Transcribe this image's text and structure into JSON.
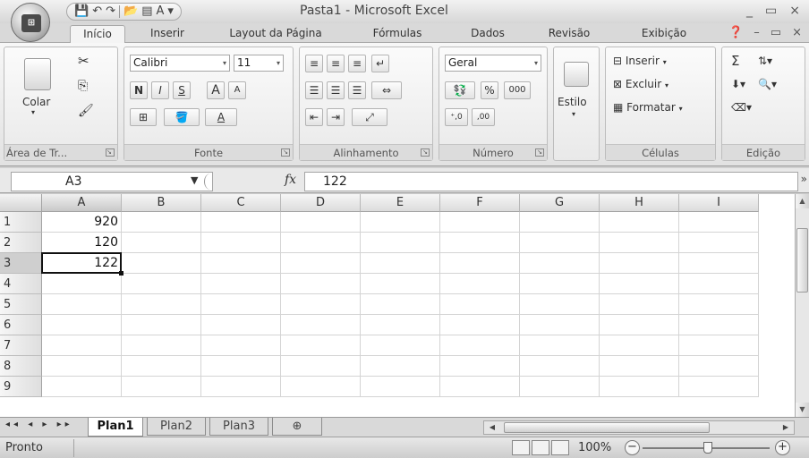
{
  "window": {
    "title": "Pasta1 - Microsoft Excel",
    "controls": [
      "_",
      "▭",
      "×"
    ]
  },
  "quick_access": {
    "save": "💾",
    "undo": "↶",
    "redo": "↷",
    "open": "📂",
    "print_preview": "▤",
    "format": "A",
    "customize": "▾"
  },
  "ribbon_tabs": [
    "Início",
    "Inserir",
    "Layout da Página",
    "Fórmulas",
    "Dados",
    "Revisão",
    "Exibição"
  ],
  "ribbon_tab_controls": [
    "❓",
    "–",
    "▭",
    "×"
  ],
  "ribbon": {
    "clipboard": {
      "paste_label": "Colar",
      "group_label": "Área de Tr...",
      "cut": "✂",
      "copy": "⎘",
      "format_painter": "🖌"
    },
    "font": {
      "font_name": "Calibri",
      "font_size": "11",
      "bold": "N",
      "italic": "I",
      "underline": "S",
      "grow": "A",
      "shrink": "A",
      "group_label": "Fonte"
    },
    "alignment": {
      "group_label": "Alinhamento"
    },
    "number": {
      "format": "Geral",
      "percent": "%",
      "thousands": "000",
      "inc_decimal": "⁺,0",
      "dec_decimal": ",00",
      "group_label": "Número"
    },
    "styles": {
      "label": "Estilo"
    },
    "cells": {
      "insert": "Inserir",
      "delete": "Excluir",
      "format": "Formatar",
      "group_label": "Células"
    },
    "editing": {
      "sum": "Σ",
      "group_label": "Edição"
    }
  },
  "formula_bar": {
    "name_box": "A3",
    "fx": "fx",
    "value": "122"
  },
  "grid": {
    "columns": [
      "A",
      "B",
      "C",
      "D",
      "E",
      "F",
      "G",
      "H",
      "I"
    ],
    "rows": [
      "1",
      "2",
      "3",
      "4",
      "5",
      "6",
      "7",
      "8",
      "9"
    ],
    "cells": {
      "A1": "920",
      "A2": "120",
      "A3": "122"
    },
    "active_cell": "A3"
  },
  "sheets": {
    "nav": "◂◂ ◂ ▸ ▸▸",
    "tabs": [
      "Plan1",
      "Plan2",
      "Plan3"
    ],
    "active": "Plan1"
  },
  "status": {
    "text": "Pronto",
    "zoom": "100%"
  }
}
